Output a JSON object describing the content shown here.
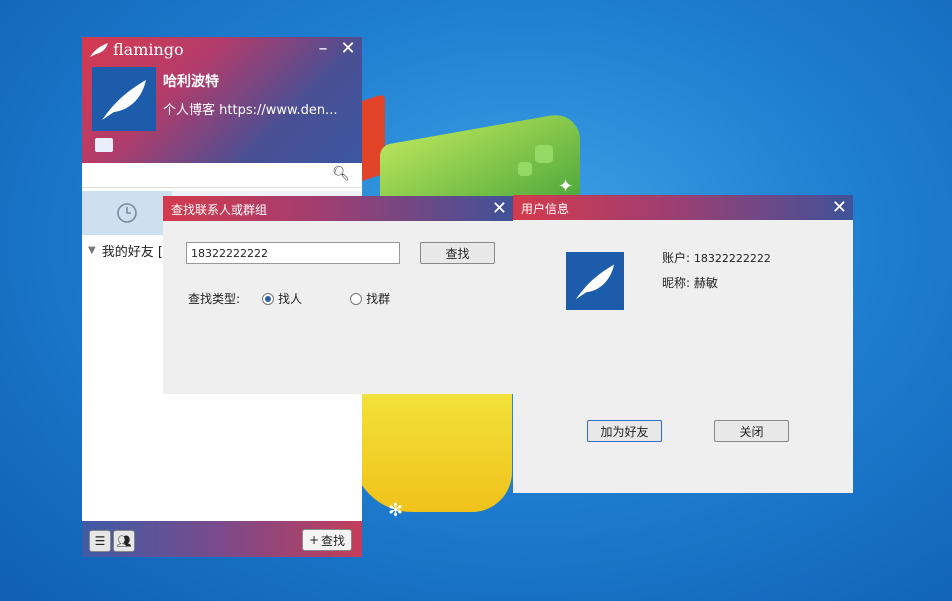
{
  "main": {
    "brand": "flamingo",
    "user_name": "哈利波特",
    "signature": "个人博客 https://www.den...",
    "tree_group": "我的好友 [",
    "find_button": "查找",
    "icons": [
      "bird-logo-icon",
      "minimize-icon",
      "close-icon",
      "mail-icon",
      "search-icon",
      "clock-icon",
      "menu-icon",
      "contacts-icon",
      "plus-icon"
    ]
  },
  "find_dialog": {
    "title": "查找联系人或群组",
    "input_value": "18322222222",
    "search_button": "查找",
    "type_label": "查找类型:",
    "option_person": "找人",
    "option_group": "找群",
    "selected": "找人"
  },
  "user_info": {
    "title": "用户信息",
    "account_label": "账户:",
    "account_value": "18322222222",
    "nick_label": "昵称:",
    "nick_value": "赫敏",
    "add_button": "加为好友",
    "close_button": "关闭"
  },
  "colors": {
    "accent_red": "#d43a4c",
    "accent_blue": "#3f5299",
    "avatar_blue": "#1c5cab"
  }
}
